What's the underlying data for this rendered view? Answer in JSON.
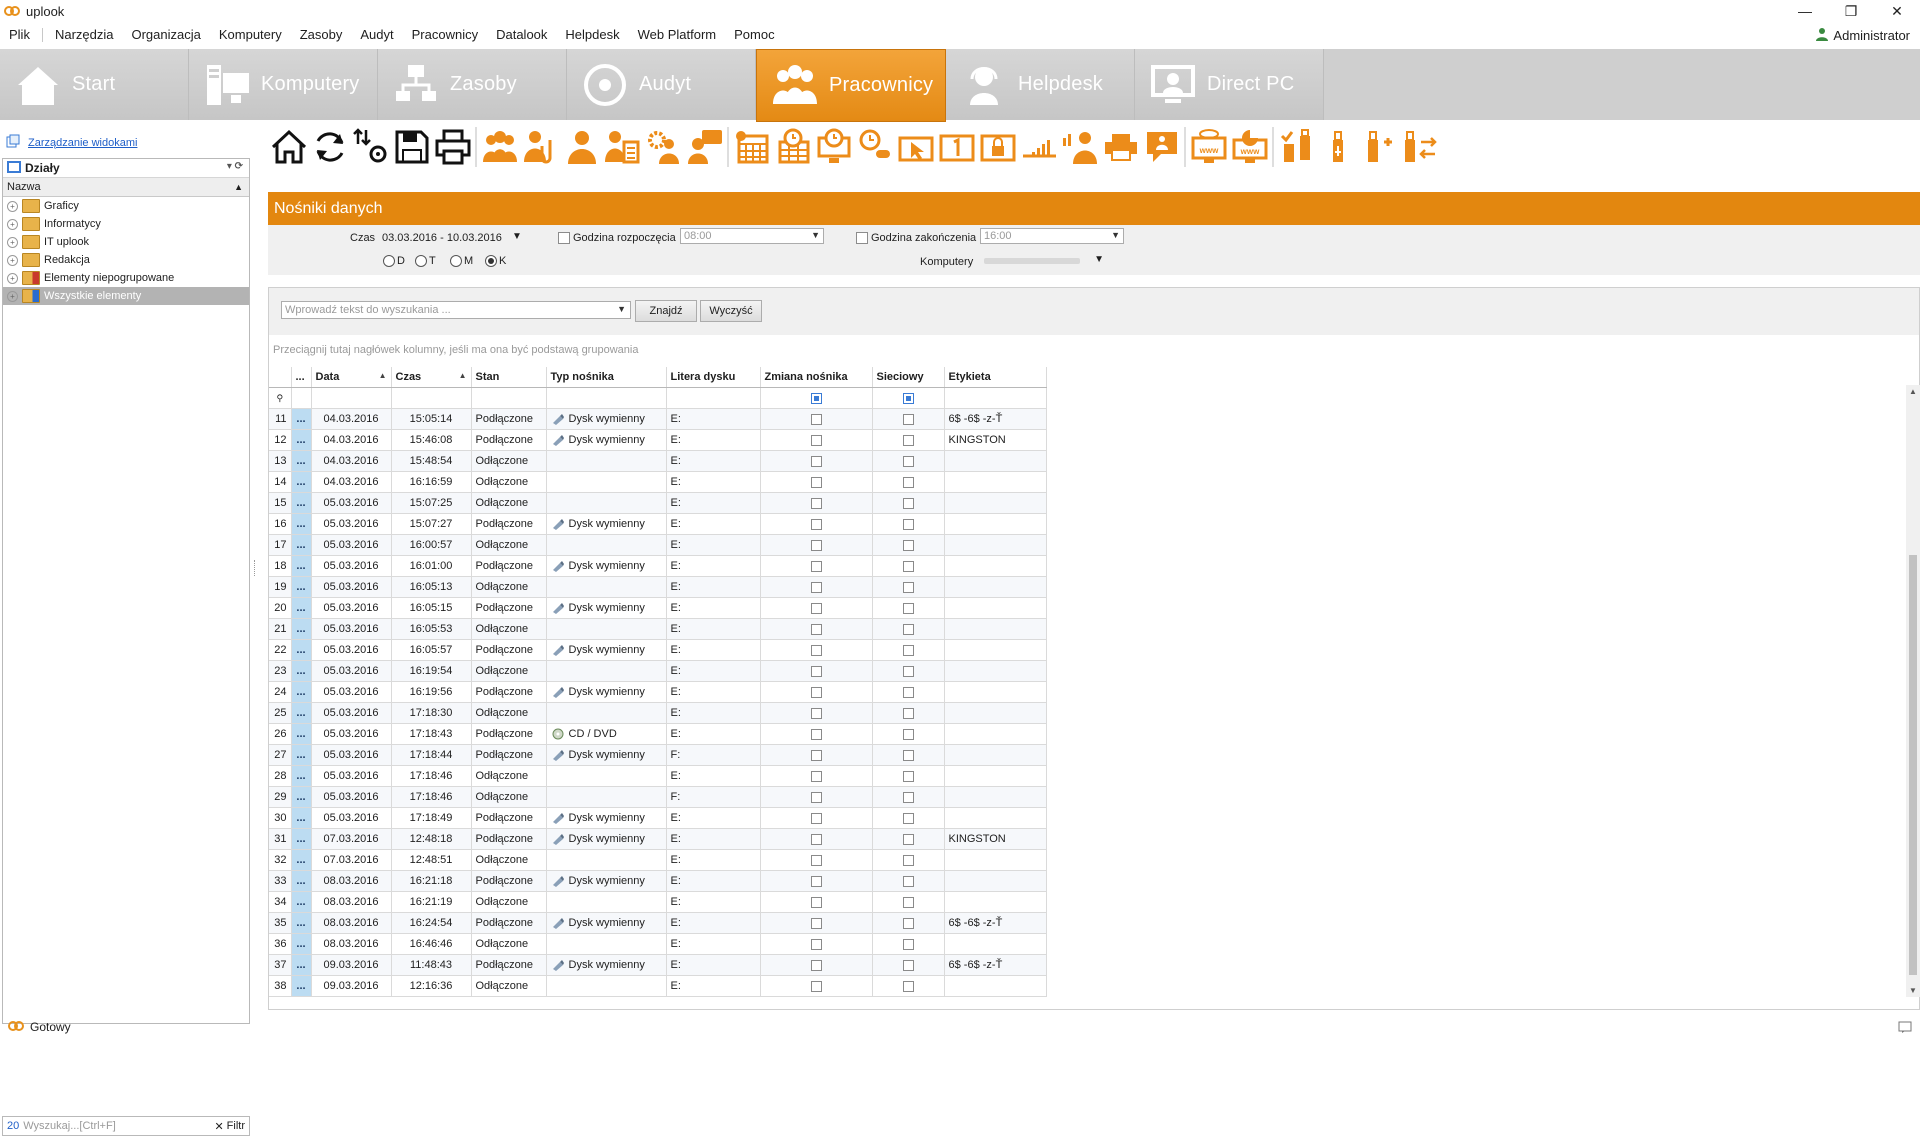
{
  "window": {
    "title": "uplook",
    "logo": "uplook-logo-icon",
    "controls": [
      "—",
      "❐",
      "✕"
    ]
  },
  "menu": [
    "Plik",
    "Narzędzia",
    "Organizacja",
    "Komputery",
    "Zasoby",
    "Audyt",
    "Pracownicy",
    "Datalook",
    "Helpdesk",
    "Web Platform",
    "Pomoc"
  ],
  "user": "Administrator",
  "nav": [
    {
      "label": "Start",
      "icon": "home-icon"
    },
    {
      "label": "Komputery",
      "icon": "computers-icon"
    },
    {
      "label": "Zasoby",
      "icon": "network-icon"
    },
    {
      "label": "Audyt",
      "icon": "disc-icon"
    },
    {
      "label": "Pracownicy",
      "icon": "people-icon",
      "active": true
    },
    {
      "label": "Helpdesk",
      "icon": "headset-icon"
    },
    {
      "label": "Direct PC",
      "icon": "remote-pc-icon"
    }
  ],
  "left": {
    "manage_views": "Zarządzanie widokami",
    "group_title": "Działy",
    "column": "Nazwa",
    "items": [
      "Graficy",
      "Informatycy",
      "IT uplook",
      "Redakcja",
      "Elementy niepogrupowane",
      "Wszystkie elementy"
    ],
    "search": {
      "count": "20",
      "placeholder": "Wyszukaj...[Ctrl+F]",
      "filter": "Filtr"
    }
  },
  "status": "Gotowy",
  "section": {
    "title": "Nośniki danych"
  },
  "filters": {
    "time_label": "Czas",
    "time_value": "03.03.2016 - 10.03.2016",
    "start_label": "Godzina rozpoczęcia",
    "start_value": "08:00",
    "end_label": "Godzina zakończenia",
    "end_value": "16:00",
    "computers_label": "Komputery",
    "radios": [
      "D",
      "T",
      "M",
      "K"
    ],
    "radio_selected": "K"
  },
  "search": {
    "placeholder": "Wprowadź tekst do wyszukania ...",
    "find": "Znajdź",
    "clear": "Wyczyść"
  },
  "group_hint": "Przeciągnij tutaj nagłówek kolumny, jeśli ma ona być podstawą grupowania",
  "columns": [
    "...",
    "Data",
    "Czas",
    "Stan",
    "Typ nośnika",
    "Litera dysku",
    "Zmiana nośnika",
    "Sieciowy",
    "Etykieta"
  ],
  "rows": [
    {
      "n": "11",
      "date": "04.03.2016",
      "time": "15:05:14",
      "state": "Podłączone",
      "type": "Dysk wymienny",
      "drive": "E:",
      "label": "6$ -6$ -z-Ť"
    },
    {
      "n": "12",
      "date": "04.03.2016",
      "time": "15:46:08",
      "state": "Podłączone",
      "type": "Dysk wymienny",
      "drive": "E:",
      "label": "KINGSTON"
    },
    {
      "n": "13",
      "date": "04.03.2016",
      "time": "15:48:54",
      "state": "Odłączone",
      "type": "",
      "drive": "E:",
      "label": ""
    },
    {
      "n": "14",
      "date": "04.03.2016",
      "time": "16:16:59",
      "state": "Odłączone",
      "type": "",
      "drive": "E:",
      "label": ""
    },
    {
      "n": "15",
      "date": "05.03.2016",
      "time": "15:07:25",
      "state": "Odłączone",
      "type": "",
      "drive": "E:",
      "label": ""
    },
    {
      "n": "16",
      "date": "05.03.2016",
      "time": "15:07:27",
      "state": "Podłączone",
      "type": "Dysk wymienny",
      "drive": "E:",
      "label": ""
    },
    {
      "n": "17",
      "date": "05.03.2016",
      "time": "16:00:57",
      "state": "Odłączone",
      "type": "",
      "drive": "E:",
      "label": ""
    },
    {
      "n": "18",
      "date": "05.03.2016",
      "time": "16:01:00",
      "state": "Podłączone",
      "type": "Dysk wymienny",
      "drive": "E:",
      "label": ""
    },
    {
      "n": "19",
      "date": "05.03.2016",
      "time": "16:05:13",
      "state": "Odłączone",
      "type": "",
      "drive": "E:",
      "label": ""
    },
    {
      "n": "20",
      "date": "05.03.2016",
      "time": "16:05:15",
      "state": "Podłączone",
      "type": "Dysk wymienny",
      "drive": "E:",
      "label": ""
    },
    {
      "n": "21",
      "date": "05.03.2016",
      "time": "16:05:53",
      "state": "Odłączone",
      "type": "",
      "drive": "E:",
      "label": ""
    },
    {
      "n": "22",
      "date": "05.03.2016",
      "time": "16:05:57",
      "state": "Podłączone",
      "type": "Dysk wymienny",
      "drive": "E:",
      "label": ""
    },
    {
      "n": "23",
      "date": "05.03.2016",
      "time": "16:19:54",
      "state": "Odłączone",
      "type": "",
      "drive": "E:",
      "label": ""
    },
    {
      "n": "24",
      "date": "05.03.2016",
      "time": "16:19:56",
      "state": "Podłączone",
      "type": "Dysk wymienny",
      "drive": "E:",
      "label": ""
    },
    {
      "n": "25",
      "date": "05.03.2016",
      "time": "17:18:30",
      "state": "Odłączone",
      "type": "",
      "drive": "E:",
      "label": ""
    },
    {
      "n": "26",
      "date": "05.03.2016",
      "time": "17:18:43",
      "state": "Podłączone",
      "type": "CD / DVD",
      "drive": "E:",
      "label": ""
    },
    {
      "n": "27",
      "date": "05.03.2016",
      "time": "17:18:44",
      "state": "Podłączone",
      "type": "Dysk wymienny",
      "drive": "F:",
      "label": ""
    },
    {
      "n": "28",
      "date": "05.03.2016",
      "time": "17:18:46",
      "state": "Odłączone",
      "type": "",
      "drive": "E:",
      "label": ""
    },
    {
      "n": "29",
      "date": "05.03.2016",
      "time": "17:18:46",
      "state": "Odłączone",
      "type": "",
      "drive": "F:",
      "label": ""
    },
    {
      "n": "30",
      "date": "05.03.2016",
      "time": "17:18:49",
      "state": "Podłączone",
      "type": "Dysk wymienny",
      "drive": "E:",
      "label": ""
    },
    {
      "n": "31",
      "date": "07.03.2016",
      "time": "12:48:18",
      "state": "Podłączone",
      "type": "Dysk wymienny",
      "drive": "E:",
      "label": "KINGSTON"
    },
    {
      "n": "32",
      "date": "07.03.2016",
      "time": "12:48:51",
      "state": "Odłączone",
      "type": "",
      "drive": "E:",
      "label": ""
    },
    {
      "n": "33",
      "date": "08.03.2016",
      "time": "16:21:18",
      "state": "Podłączone",
      "type": "Dysk wymienny",
      "drive": "E:",
      "label": ""
    },
    {
      "n": "34",
      "date": "08.03.2016",
      "time": "16:21:19",
      "state": "Odłączone",
      "type": "",
      "drive": "E:",
      "label": ""
    },
    {
      "n": "35",
      "date": "08.03.2016",
      "time": "16:24:54",
      "state": "Podłączone",
      "type": "Dysk wymienny",
      "drive": "E:",
      "label": "6$ -6$ -z-Ť"
    },
    {
      "n": "36",
      "date": "08.03.2016",
      "time": "16:46:46",
      "state": "Odłączone",
      "type": "",
      "drive": "E:",
      "label": ""
    },
    {
      "n": "37",
      "date": "09.03.2016",
      "time": "11:48:43",
      "state": "Podłączone",
      "type": "Dysk wymienny",
      "drive": "E:",
      "label": "6$ -6$ -z-Ť"
    },
    {
      "n": "38",
      "date": "09.03.2016",
      "time": "12:16:36",
      "state": "Odłączone",
      "type": "",
      "drive": "E:",
      "label": ""
    }
  ],
  "colors": {
    "accent": "#e3870f",
    "nav_bg": "#cfcfcf",
    "row_marker": "#bcdcf2",
    "link": "#1e5ec8"
  },
  "toolbar_icons": [
    "home-icon",
    "refresh-icon",
    "sort-settings-icon",
    "save-icon",
    "print-icon",
    "users-group-icon",
    "user-attach-icon",
    "user-icon",
    "user-documents-icon",
    "user-settings-icon",
    "user-chat-icon",
    "calendar-grid-icon",
    "calendar-clock-icon",
    "computer-clock-icon",
    "mouse-clock-icon",
    "cursor-window-icon",
    "keyboard-one-icon",
    "lock-window-icon",
    "signal-bars-icon",
    "user-chart-icon",
    "printer-icon",
    "message-icon",
    "www-eye-icon",
    "www-chart-icon",
    "usb-check-icon",
    "usb-icon",
    "usb-plug-icon",
    "usb-transfer-icon"
  ]
}
